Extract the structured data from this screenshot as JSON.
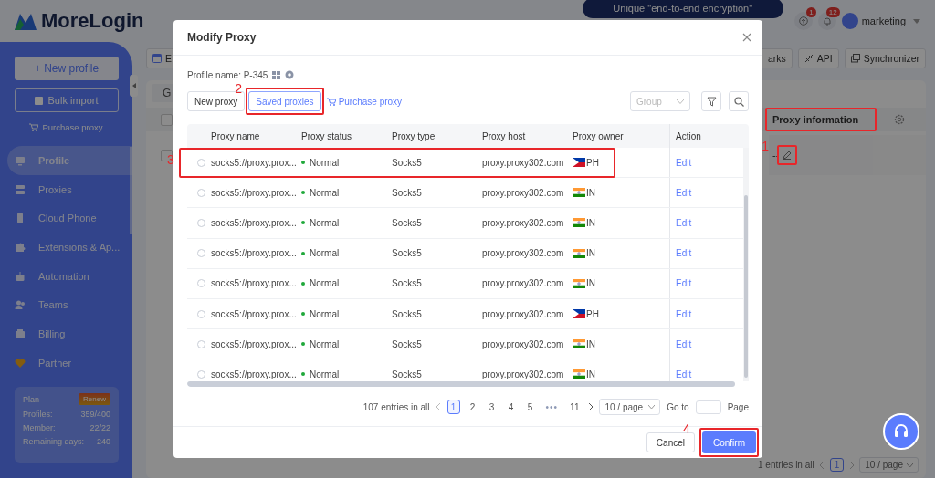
{
  "header": {
    "logo": "MoreLogin",
    "banner": "Unique \"end-to-end encryption\"",
    "update_badge": "1",
    "notice_badge": "12",
    "user": "marketing"
  },
  "sidebar": {
    "new_profile": "+ New profile",
    "bulk_import": "Bulk import",
    "purchase_proxy": "Purchase proxy",
    "items": [
      {
        "label": "Profile",
        "selected": true
      },
      {
        "label": "Proxies",
        "selected": false
      },
      {
        "label": "Cloud Phone",
        "selected": false
      },
      {
        "label": "Extensions & Ap...",
        "selected": false
      },
      {
        "label": "Automation",
        "selected": false
      },
      {
        "label": "Teams",
        "selected": false
      },
      {
        "label": "Billing",
        "selected": false
      },
      {
        "label": "Partner",
        "selected": false
      }
    ],
    "plan": {
      "label": "Plan",
      "renew": "Renew",
      "rows": [
        {
          "label": "Profiles:",
          "value": "359/400"
        },
        {
          "label": "Member:",
          "value": "22/22"
        },
        {
          "label": "Remaining days:",
          "value": "240"
        }
      ]
    }
  },
  "main": {
    "left_tool": "E",
    "category_tab": "G",
    "toolbar": [
      "arks",
      "API",
      "Synchronizer"
    ],
    "column": "Proxy information",
    "header_checked": false,
    "rows": [
      {
        "proxy": "--",
        "checked": false
      }
    ],
    "total": "1 entries in all",
    "page": "1",
    "page_size": "10 / page"
  },
  "modal": {
    "title": "Modify Proxy",
    "profile_label": "Profile name: P-345",
    "tabs": [
      {
        "label": "New proxy",
        "selected": false
      },
      {
        "label": "Saved proxies",
        "selected": true
      }
    ],
    "purchase_link": "Purchase proxy",
    "group_placeholder": "Group",
    "columns": [
      "Proxy name",
      "Proxy status",
      "Proxy type",
      "Proxy host",
      "Proxy owner",
      "Action"
    ],
    "rows": [
      {
        "name": "socks5://proxy.prox...",
        "status": "Normal",
        "type": "Socks5",
        "host": "proxy.proxy302.com",
        "kind": "ph",
        "owner": "PH",
        "action": "Edit",
        "selected": false
      },
      {
        "name": "socks5://proxy.prox...",
        "status": "Normal",
        "type": "Socks5",
        "host": "proxy.proxy302.com",
        "kind": "in",
        "owner": "IN",
        "action": "Edit",
        "selected": false
      },
      {
        "name": "socks5://proxy.prox...",
        "status": "Normal",
        "type": "Socks5",
        "host": "proxy.proxy302.com",
        "kind": "in",
        "owner": "IN",
        "action": "Edit",
        "selected": false
      },
      {
        "name": "socks5://proxy.prox...",
        "status": "Normal",
        "type": "Socks5",
        "host": "proxy.proxy302.com",
        "kind": "in",
        "owner": "IN",
        "action": "Edit",
        "selected": false
      },
      {
        "name": "socks5://proxy.prox...",
        "status": "Normal",
        "type": "Socks5",
        "host": "proxy.proxy302.com",
        "kind": "in",
        "owner": "IN",
        "action": "Edit",
        "selected": false
      },
      {
        "name": "socks5://proxy.prox...",
        "status": "Normal",
        "type": "Socks5",
        "host": "proxy.proxy302.com",
        "kind": "ph",
        "owner": "PH",
        "action": "Edit",
        "selected": false
      },
      {
        "name": "socks5://proxy.prox...",
        "status": "Normal",
        "type": "Socks5",
        "host": "proxy.proxy302.com",
        "kind": "in",
        "owner": "IN",
        "action": "Edit",
        "selected": false
      },
      {
        "name": "socks5://proxy.prox...",
        "status": "Normal",
        "type": "Socks5",
        "host": "proxy.proxy302.com",
        "kind": "in",
        "owner": "IN",
        "action": "Edit",
        "selected": false
      }
    ],
    "pagination": {
      "total": "107 entries in all",
      "pages": [
        {
          "label": "1",
          "selected": true
        },
        {
          "label": "2",
          "selected": false
        },
        {
          "label": "3",
          "selected": false
        },
        {
          "label": "4",
          "selected": false
        },
        {
          "label": "5",
          "selected": false
        },
        {
          "label": "•••",
          "selected": false
        },
        {
          "label": "11",
          "selected": false
        }
      ],
      "page_size": "10 / page",
      "goto": "Go to",
      "page_label": "Page"
    },
    "cancel": "Cancel",
    "confirm": "Confirm"
  },
  "annotations": [
    {
      "number": "1"
    },
    {
      "number": "2"
    },
    {
      "number": "3"
    },
    {
      "number": "4"
    }
  ]
}
